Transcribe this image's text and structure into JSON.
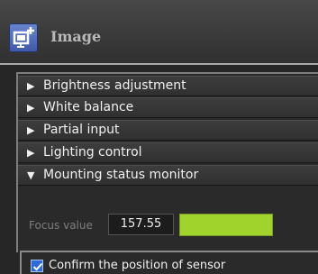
{
  "header": {
    "title": "Image",
    "icon": "image-add-icon"
  },
  "sections": [
    {
      "label": "Brightness adjustment",
      "expanded": false
    },
    {
      "label": "White balance",
      "expanded": false
    },
    {
      "label": "Partial input",
      "expanded": false
    },
    {
      "label": "Lighting control",
      "expanded": false
    },
    {
      "label": "Mounting status monitor",
      "expanded": true
    }
  ],
  "focus": {
    "label": "Focus value",
    "value": "157.55",
    "indicator_color": "#a0d42c"
  },
  "confirm": {
    "label": "Confirm the position of sensor",
    "checked": true
  },
  "colors": {
    "accent_blue": "#2d6bd8",
    "focus_green": "#a0d42c"
  }
}
